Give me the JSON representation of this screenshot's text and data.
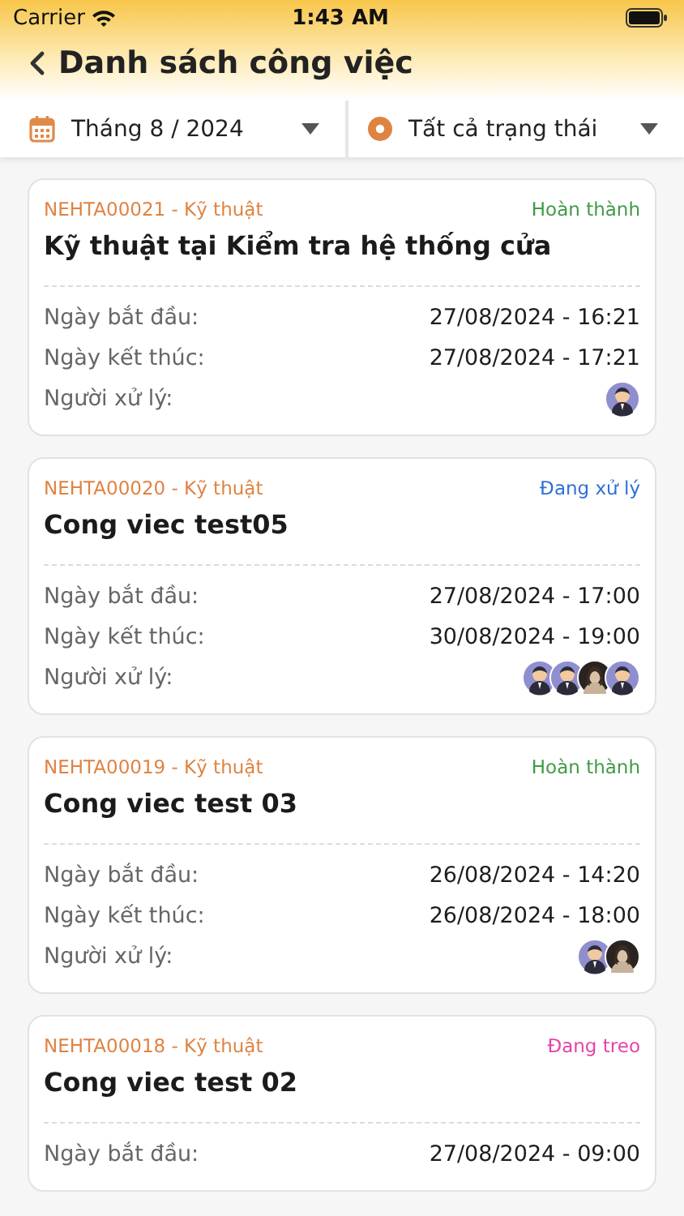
{
  "status_bar": {
    "carrier": "Carrier",
    "time": "1:43 AM"
  },
  "header": {
    "title": "Danh sách công việc"
  },
  "filters": [
    {
      "kind": "month",
      "label": "Tháng 8 / 2024"
    },
    {
      "kind": "status",
      "label": "Tất cả trạng thái"
    }
  ],
  "tasks": [
    {
      "code": "NEHTA00021 - Kỹ thuật",
      "status": "Hoàn thành",
      "color": "#3f9b45",
      "title": "Kỹ thuật tại Kiểm tra hệ thống cửa",
      "fields": [
        {
          "label": "Ngày bắt đầu:",
          "value": "27/08/2024 - 16:21"
        },
        {
          "label": "Ngày kết thúc:",
          "value": "27/08/2024 - 17:21"
        }
      ],
      "assignee_label": "Người xử lý:",
      "assignees": [
        {
          "kind": "cartoon"
        }
      ]
    },
    {
      "code": "NEHTA00020 - Kỹ thuật",
      "status": "Đang xử lý",
      "color": "#2f6fd6",
      "title": "Cong viec test05",
      "fields": [
        {
          "label": "Ngày bắt đầu:",
          "value": "27/08/2024 - 17:00"
        },
        {
          "label": "Ngày kết thúc:",
          "value": "30/08/2024 - 19:00"
        }
      ],
      "assignee_label": "Người xử lý:",
      "assignees": [
        {
          "kind": "cartoon"
        },
        {
          "kind": "cartoon"
        },
        {
          "kind": "photo"
        },
        {
          "kind": "cartoon"
        }
      ]
    },
    {
      "code": "NEHTA00019 - Kỹ thuật",
      "status": "Hoàn thành",
      "color": "#3f9b45",
      "title": "Cong viec test 03",
      "fields": [
        {
          "label": "Ngày bắt đầu:",
          "value": "26/08/2024 - 14:20"
        },
        {
          "label": "Ngày kết thúc:",
          "value": "26/08/2024 - 18:00"
        }
      ],
      "assignee_label": "Người xử lý:",
      "assignees": [
        {
          "kind": "cartoon"
        },
        {
          "kind": "photo"
        }
      ]
    },
    {
      "code": "NEHTA00018 - Kỹ thuật",
      "status": "Đang treo",
      "color": "#e542a8",
      "title": "Cong viec test 02",
      "fields": [
        {
          "label": "Ngày bắt đầu:",
          "value": "27/08/2024 - 09:00"
        }
      ]
    }
  ]
}
